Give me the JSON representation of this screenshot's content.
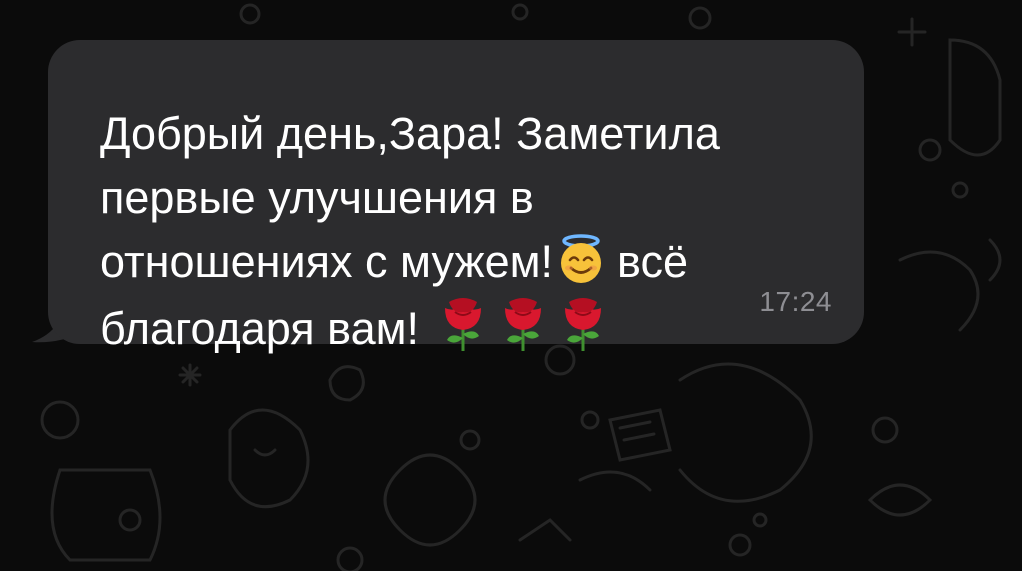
{
  "message": {
    "line1": "Добрый день,Зара! Заметила",
    "line2": "первые улучшения в",
    "line3": "отношениях с мужем!",
    "line3_after": "всё",
    "line4": "благодаря вам!",
    "emoji_angel": "smiling-face-with-halo",
    "emoji_rose": "rose",
    "time": "17:24"
  },
  "colors": {
    "background": "#0b0b0b",
    "bubble": "#2c2c2e",
    "text": "#ffffff",
    "time": "#8e8e93",
    "wallpaper_doodle": "#2a2a2a"
  }
}
